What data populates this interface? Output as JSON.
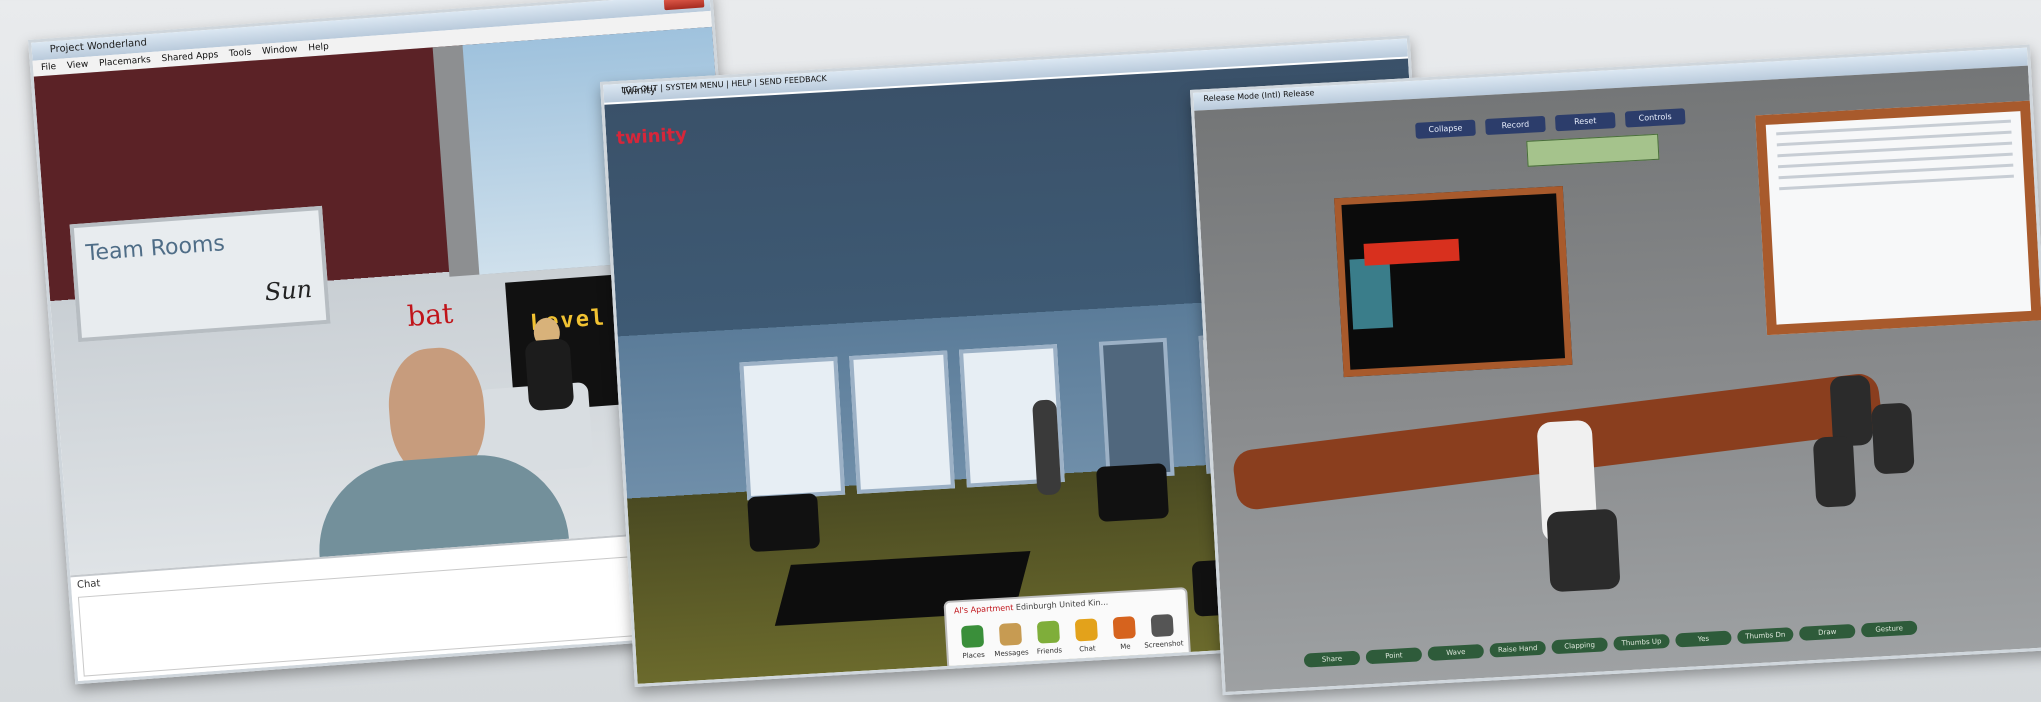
{
  "win1": {
    "title": "Project Wonderland",
    "menu": [
      "File",
      "View",
      "Placemarks",
      "Shared Apps",
      "Tools",
      "Window",
      "Help"
    ],
    "sign_text": "Team Rooms",
    "sign_logo": "Sun",
    "poster_text": "Level Up",
    "avatar_name": "bat",
    "chat_label": "Chat"
  },
  "win2": {
    "title": "Twinity",
    "brand": "twinity",
    "top_menu": "LOG OUT | SYSTEM MENU | HELP | SEND FEEDBACK",
    "dock": {
      "location_prefix": "Al's Apartment",
      "location_rest": "Edinburgh  United Kin..."
    },
    "dock_items": [
      {
        "label": "Places",
        "color": "#3a8f3a"
      },
      {
        "label": "Messages",
        "color": "#c79b52"
      },
      {
        "label": "Friends",
        "color": "#7fae3a"
      },
      {
        "label": "Chat",
        "color": "#e3a21b"
      },
      {
        "label": "Me",
        "color": "#d6631e"
      },
      {
        "label": "Screenshot",
        "color": "#555555"
      }
    ]
  },
  "win3": {
    "tab_text": "Release Mode (Intl) Release",
    "top_buttons": [
      "Collapse",
      "Record",
      "Reset",
      "Controls"
    ],
    "bottom_buttons": [
      "Share",
      "Point",
      "Wave",
      "Raise Hand",
      "Clapping",
      "Thumbs Up",
      "Yes",
      "Thumbs Dn",
      "Draw",
      "Gesture"
    ]
  }
}
